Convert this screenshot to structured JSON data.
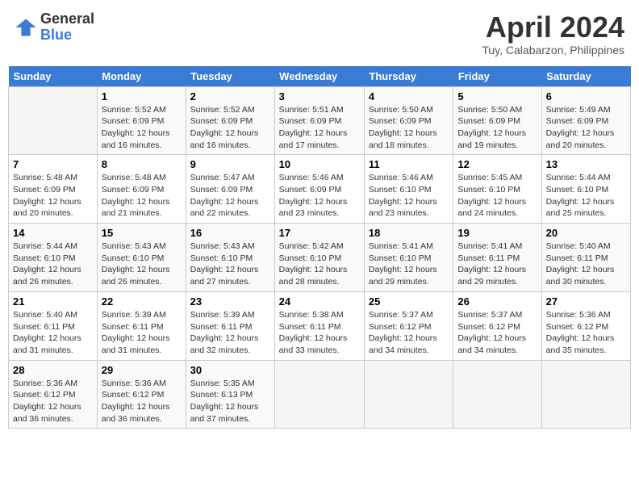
{
  "header": {
    "logo_general": "General",
    "logo_blue": "Blue",
    "month_title": "April 2024",
    "location": "Tuy, Calabarzon, Philippines"
  },
  "calendar": {
    "days_of_week": [
      "Sunday",
      "Monday",
      "Tuesday",
      "Wednesday",
      "Thursday",
      "Friday",
      "Saturday"
    ],
    "weeks": [
      [
        {
          "day": "",
          "info": ""
        },
        {
          "day": "1",
          "info": "Sunrise: 5:52 AM\nSunset: 6:09 PM\nDaylight: 12 hours and 16 minutes."
        },
        {
          "day": "2",
          "info": "Sunrise: 5:52 AM\nSunset: 6:09 PM\nDaylight: 12 hours and 16 minutes."
        },
        {
          "day": "3",
          "info": "Sunrise: 5:51 AM\nSunset: 6:09 PM\nDaylight: 12 hours and 17 minutes."
        },
        {
          "day": "4",
          "info": "Sunrise: 5:50 AM\nSunset: 6:09 PM\nDaylight: 12 hours and 18 minutes."
        },
        {
          "day": "5",
          "info": "Sunrise: 5:50 AM\nSunset: 6:09 PM\nDaylight: 12 hours and 19 minutes."
        },
        {
          "day": "6",
          "info": "Sunrise: 5:49 AM\nSunset: 6:09 PM\nDaylight: 12 hours and 20 minutes."
        }
      ],
      [
        {
          "day": "7",
          "info": "Sunrise: 5:48 AM\nSunset: 6:09 PM\nDaylight: 12 hours and 20 minutes."
        },
        {
          "day": "8",
          "info": "Sunrise: 5:48 AM\nSunset: 6:09 PM\nDaylight: 12 hours and 21 minutes."
        },
        {
          "day": "9",
          "info": "Sunrise: 5:47 AM\nSunset: 6:09 PM\nDaylight: 12 hours and 22 minutes."
        },
        {
          "day": "10",
          "info": "Sunrise: 5:46 AM\nSunset: 6:09 PM\nDaylight: 12 hours and 23 minutes."
        },
        {
          "day": "11",
          "info": "Sunrise: 5:46 AM\nSunset: 6:10 PM\nDaylight: 12 hours and 23 minutes."
        },
        {
          "day": "12",
          "info": "Sunrise: 5:45 AM\nSunset: 6:10 PM\nDaylight: 12 hours and 24 minutes."
        },
        {
          "day": "13",
          "info": "Sunrise: 5:44 AM\nSunset: 6:10 PM\nDaylight: 12 hours and 25 minutes."
        }
      ],
      [
        {
          "day": "14",
          "info": "Sunrise: 5:44 AM\nSunset: 6:10 PM\nDaylight: 12 hours and 26 minutes."
        },
        {
          "day": "15",
          "info": "Sunrise: 5:43 AM\nSunset: 6:10 PM\nDaylight: 12 hours and 26 minutes."
        },
        {
          "day": "16",
          "info": "Sunrise: 5:43 AM\nSunset: 6:10 PM\nDaylight: 12 hours and 27 minutes."
        },
        {
          "day": "17",
          "info": "Sunrise: 5:42 AM\nSunset: 6:10 PM\nDaylight: 12 hours and 28 minutes."
        },
        {
          "day": "18",
          "info": "Sunrise: 5:41 AM\nSunset: 6:10 PM\nDaylight: 12 hours and 29 minutes."
        },
        {
          "day": "19",
          "info": "Sunrise: 5:41 AM\nSunset: 6:11 PM\nDaylight: 12 hours and 29 minutes."
        },
        {
          "day": "20",
          "info": "Sunrise: 5:40 AM\nSunset: 6:11 PM\nDaylight: 12 hours and 30 minutes."
        }
      ],
      [
        {
          "day": "21",
          "info": "Sunrise: 5:40 AM\nSunset: 6:11 PM\nDaylight: 12 hours and 31 minutes."
        },
        {
          "day": "22",
          "info": "Sunrise: 5:39 AM\nSunset: 6:11 PM\nDaylight: 12 hours and 31 minutes."
        },
        {
          "day": "23",
          "info": "Sunrise: 5:39 AM\nSunset: 6:11 PM\nDaylight: 12 hours and 32 minutes."
        },
        {
          "day": "24",
          "info": "Sunrise: 5:38 AM\nSunset: 6:11 PM\nDaylight: 12 hours and 33 minutes."
        },
        {
          "day": "25",
          "info": "Sunrise: 5:37 AM\nSunset: 6:12 PM\nDaylight: 12 hours and 34 minutes."
        },
        {
          "day": "26",
          "info": "Sunrise: 5:37 AM\nSunset: 6:12 PM\nDaylight: 12 hours and 34 minutes."
        },
        {
          "day": "27",
          "info": "Sunrise: 5:36 AM\nSunset: 6:12 PM\nDaylight: 12 hours and 35 minutes."
        }
      ],
      [
        {
          "day": "28",
          "info": "Sunrise: 5:36 AM\nSunset: 6:12 PM\nDaylight: 12 hours and 36 minutes."
        },
        {
          "day": "29",
          "info": "Sunrise: 5:36 AM\nSunset: 6:12 PM\nDaylight: 12 hours and 36 minutes."
        },
        {
          "day": "30",
          "info": "Sunrise: 5:35 AM\nSunset: 6:13 PM\nDaylight: 12 hours and 37 minutes."
        },
        {
          "day": "",
          "info": ""
        },
        {
          "day": "",
          "info": ""
        },
        {
          "day": "",
          "info": ""
        },
        {
          "day": "",
          "info": ""
        }
      ]
    ]
  }
}
